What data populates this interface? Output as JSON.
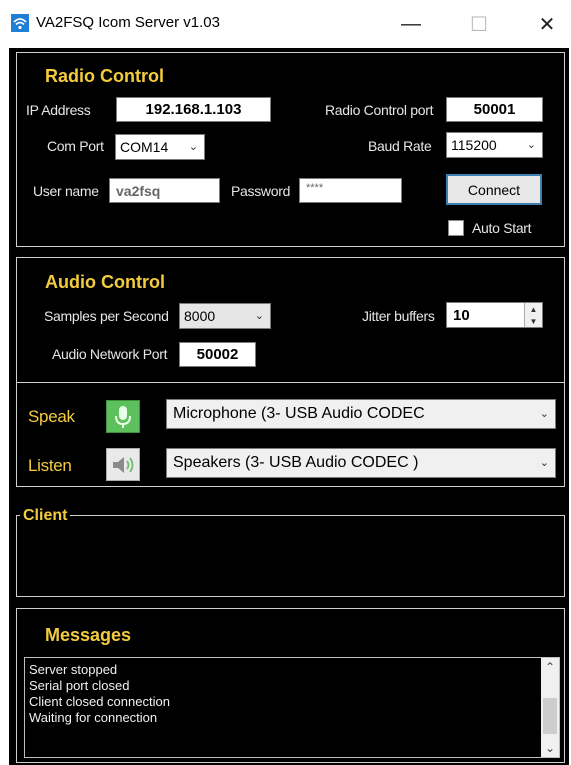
{
  "window": {
    "title": "VA2FSQ Icom Server v1.03",
    "minimize_icon": "minimize-icon",
    "maximize_icon": "maximize-icon",
    "close_icon": "close-icon"
  },
  "radio_control": {
    "heading": "Radio Control",
    "ip_label": "IP Address",
    "ip_value": "192.168.1.103",
    "port_label": "Radio Control port",
    "port_value": "50001",
    "com_label": "Com Port",
    "com_value": "COM14",
    "baud_label": "Baud Rate",
    "baud_value": "115200",
    "user_label": "User name",
    "user_value": "va2fsq",
    "password_label": "Password",
    "password_value": "****",
    "connect_label": "Connect",
    "autostart_label": "Auto Start"
  },
  "audio_control": {
    "heading": "Audio Control",
    "samples_label": "Samples per Second",
    "samples_value": "8000",
    "jitter_label": "Jitter buffers",
    "jitter_value": "10",
    "netport_label": "Audio Network Port",
    "netport_value": "50002"
  },
  "devices": {
    "speak_label": "Speak",
    "speak_device": "Microphone (3- USB Audio CODEC",
    "listen_label": "Listen",
    "listen_device": "Speakers (3- USB Audio CODEC )"
  },
  "client": {
    "heading": "Client"
  },
  "messages": {
    "heading": "Messages",
    "lines": [
      "Server stopped",
      "Serial port closed",
      "Client closed connection",
      "Waiting for connection"
    ]
  },
  "colors": {
    "background": "#000000",
    "heading": "#f3cc3d",
    "accent": "#3c7fb1",
    "mic_icon_bg": "#5cc15c"
  }
}
